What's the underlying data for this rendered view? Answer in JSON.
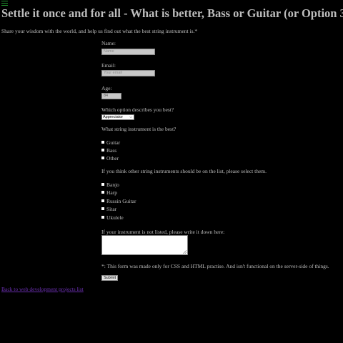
{
  "nav": {
    "menu_icon": "hamburger-menu-icon"
  },
  "header": {
    "title": "Settle it once and for all - What is better, Bass or Guitar (or Option 3)",
    "intro": "Share your wisdom with the world, and help us find out what the best string instrument is.*"
  },
  "form": {
    "name": {
      "label": "Name:",
      "placeholder": "Name"
    },
    "email": {
      "label": "Email:",
      "placeholder": "Your email"
    },
    "age": {
      "label": "Age:",
      "value": "84"
    },
    "describe": {
      "label": "Which option describes you best?",
      "selected": "Appreciator"
    },
    "best": {
      "label": "What string instrument is the best?",
      "options": [
        "Guitar",
        "Bass",
        "Other"
      ]
    },
    "others": {
      "label": "If you think other string instruments should be on the list, please select them.",
      "options": [
        "Banjo",
        "Harp",
        "Russin Guitar",
        "Sitar",
        "Ukulele"
      ]
    },
    "write_in": {
      "label": "If your instrument is not listed, please write it down here:"
    },
    "footnote": "*: This form was made only for CSS and HTML practise. And isn't functional on the server-side of things.",
    "submit_label": "Submit"
  },
  "footer": {
    "back_link": "Back to web development projects list"
  },
  "colors": {
    "background": "#000000",
    "text": "#bdbdbd",
    "link": "#6a2fb0",
    "menu_icon": "#1e8f2c"
  }
}
